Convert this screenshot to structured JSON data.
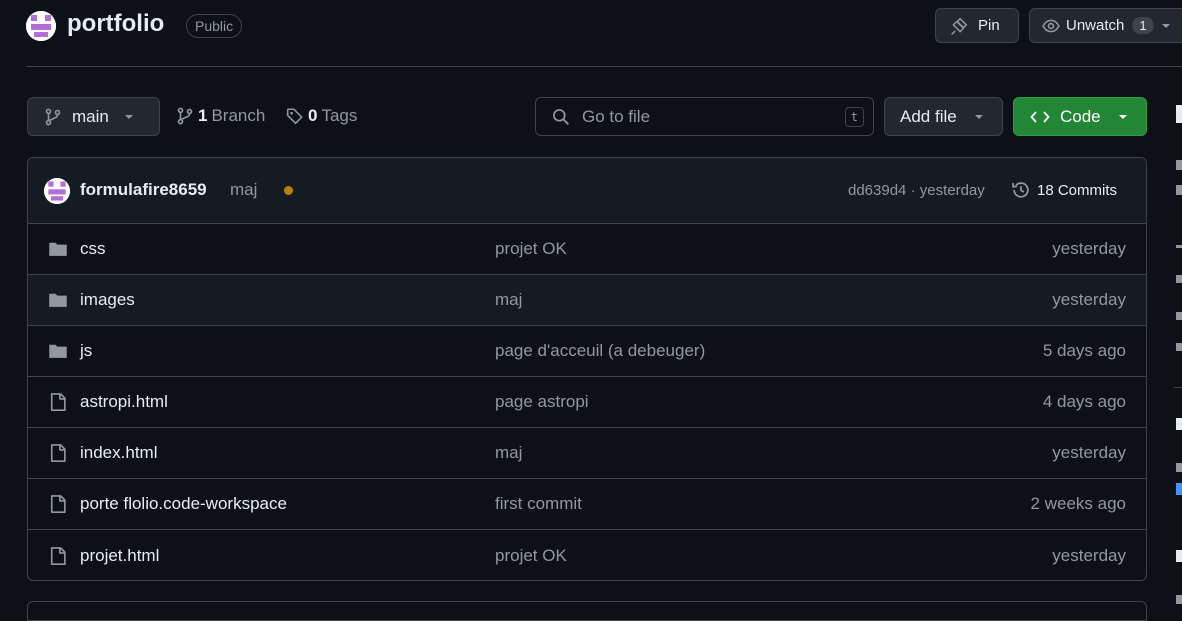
{
  "header": {
    "repo_name": "portfolio",
    "visibility": "Public",
    "pin_label": "Pin",
    "watch_label": "Unwatch",
    "watch_count": "1"
  },
  "toolbar": {
    "branch": "main",
    "branch_count": "1",
    "branch_label": "Branch",
    "tag_count": "0",
    "tag_label": "Tags",
    "search_placeholder": "Go to file",
    "search_shortcut": "t",
    "add_file_label": "Add file",
    "code_label": "Code"
  },
  "commit": {
    "author": "formulafire8659",
    "message": "maj",
    "status_color": "#bb8009",
    "hash_time": "dd639d4 · yesterday",
    "commits_label": "18 Commits"
  },
  "files": [
    {
      "type": "folder",
      "name": "css",
      "message": "projet OK",
      "date": "yesterday"
    },
    {
      "type": "folder",
      "name": "images",
      "message": "maj",
      "date": "yesterday"
    },
    {
      "type": "folder",
      "name": "js",
      "message": "page d'acceuil (a debeuger)",
      "date": "5 days ago"
    },
    {
      "type": "file",
      "name": "astropi.html",
      "message": "page astropi",
      "date": "4 days ago"
    },
    {
      "type": "file",
      "name": "index.html",
      "message": "maj",
      "date": "yesterday"
    },
    {
      "type": "file",
      "name": "porte flolio.code-workspace",
      "message": "first commit",
      "date": "2 weeks ago"
    },
    {
      "type": "file",
      "name": "projet.html",
      "message": "projet OK",
      "date": "yesterday"
    }
  ],
  "colors": {
    "background": "#0d1117",
    "border": "#3d444d",
    "accent_green": "#238636",
    "muted_text": "#9198a1",
    "link_blue": "#4493f8"
  }
}
